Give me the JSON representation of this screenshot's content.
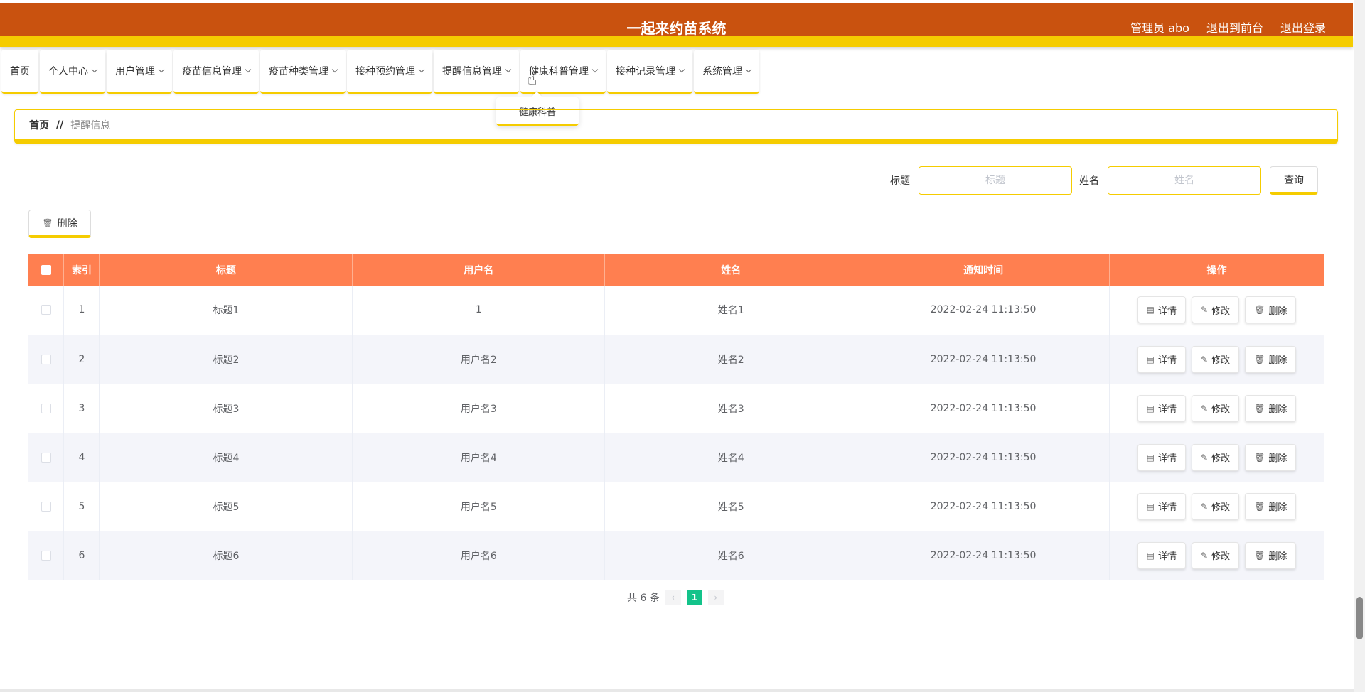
{
  "header": {
    "title": "一起来约苗系统",
    "user": "管理员 abo",
    "to_front": "退出到前台",
    "logout": "退出登录"
  },
  "nav": [
    {
      "label": "首页",
      "has_dropdown": false
    },
    {
      "label": "个人中心",
      "has_dropdown": true
    },
    {
      "label": "用户管理",
      "has_dropdown": true
    },
    {
      "label": "疫苗信息管理",
      "has_dropdown": true
    },
    {
      "label": "疫苗种类管理",
      "has_dropdown": true
    },
    {
      "label": "接种预约管理",
      "has_dropdown": true
    },
    {
      "label": "提醒信息管理",
      "has_dropdown": true
    },
    {
      "label": "健康科普管理",
      "has_dropdown": true
    },
    {
      "label": "接种记录管理",
      "has_dropdown": true
    },
    {
      "label": "系统管理",
      "has_dropdown": true
    }
  ],
  "dropdown": {
    "item": "健康科普"
  },
  "breadcrumb": {
    "home": "首页",
    "separator": "//",
    "current": "提醒信息"
  },
  "search": {
    "title_label": "标题",
    "title_placeholder": "标题",
    "name_label": "姓名",
    "name_placeholder": "姓名",
    "query_button": "查询"
  },
  "toolbar": {
    "delete_label": "删除"
  },
  "table": {
    "columns": [
      "索引",
      "标题",
      "用户名",
      "姓名",
      "通知时间",
      "操作"
    ],
    "rows": [
      {
        "index": "1",
        "title": "标题1",
        "username": "1",
        "name": "姓名1",
        "time": "2022-02-24 11:13:50"
      },
      {
        "index": "2",
        "title": "标题2",
        "username": "用户名2",
        "name": "姓名2",
        "time": "2022-02-24 11:13:50"
      },
      {
        "index": "3",
        "title": "标题3",
        "username": "用户名3",
        "name": "姓名3",
        "time": "2022-02-24 11:13:50"
      },
      {
        "index": "4",
        "title": "标题4",
        "username": "用户名4",
        "name": "姓名4",
        "time": "2022-02-24 11:13:50"
      },
      {
        "index": "5",
        "title": "标题5",
        "username": "用户名5",
        "name": "姓名5",
        "time": "2022-02-24 11:13:50"
      },
      {
        "index": "6",
        "title": "标题6",
        "username": "用户名6",
        "name": "姓名6",
        "time": "2022-02-24 11:13:50"
      }
    ],
    "actions": {
      "detail": "详情",
      "edit": "修改",
      "delete": "删除"
    }
  },
  "pagination": {
    "total_text": "共 6 条",
    "current_page": "1"
  },
  "colors": {
    "header_bg": "#c9520f",
    "accent_yellow": "#f5cc00",
    "table_header": "#ff7f50",
    "page_active": "#13c38a"
  }
}
